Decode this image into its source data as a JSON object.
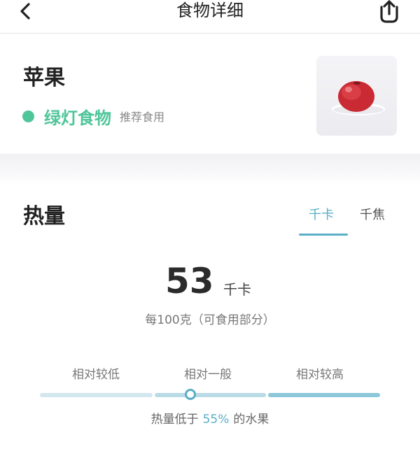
{
  "header": {
    "title": "食物详细",
    "back_icon": "chevron-left-icon",
    "share_icon": "share-upload-icon"
  },
  "food": {
    "name": "苹果",
    "light_label": "绿灯食物",
    "light_desc": "推荐食用",
    "light_color": "#4fc59a",
    "image_icon": "apple-photo"
  },
  "energy": {
    "title": "热量",
    "tabs": [
      {
        "label": "千卡",
        "active": true
      },
      {
        "label": "千焦",
        "active": false
      }
    ],
    "value": "53",
    "unit": "千卡",
    "per_note": "每100克（可食用部分）",
    "levels": [
      "相对较低",
      "相对一般",
      "相对较高"
    ],
    "compare_prefix": "热量低于",
    "compare_pct": "55%",
    "compare_suffix": "的水果",
    "accent_color": "#5aaec6"
  }
}
